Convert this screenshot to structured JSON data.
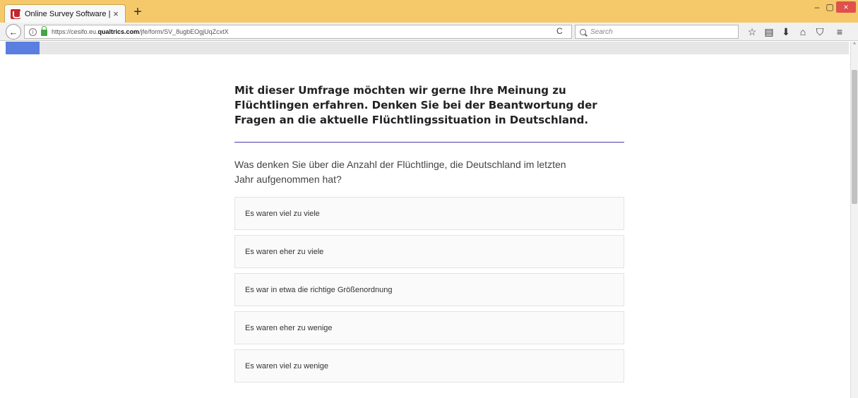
{
  "browser": {
    "tab_title": "Online Survey Software | ...",
    "tab_close": "×",
    "new_tab": "+",
    "url_prefix": "https://cesifo.eu.",
    "url_domain": "qualtrics.com",
    "url_path": "/jfe/form/SV_8ugbEOgjUqZcxtX",
    "search_placeholder": "Search",
    "reload": "C",
    "window_min": "–",
    "window_max": "▢",
    "window_close": "×",
    "back": "←",
    "info": "i",
    "toolbar_icons": [
      "star-icon",
      "reading-list-icon",
      "download-icon",
      "home-icon",
      "pocket-icon",
      "menu-icon"
    ],
    "toolbar_glyphs": [
      "☆",
      "▤",
      "⬇",
      "⌂",
      "⛉",
      "≡"
    ]
  },
  "progress": {
    "fraction": 0.04
  },
  "survey": {
    "intro": "Mit dieser Umfrage möchten wir gerne Ihre Meinung zu Flüchtlingen erfahren. Denken Sie bei der Beantwortung der Fragen an die aktuelle Flüchtlingssituation in Deutschland.",
    "question": "Was denken Sie über die Anzahl der Flüchtlinge, die Deutschland im letzten Jahr aufgenommen hat?",
    "options": [
      "Es waren viel zu viele",
      "Es waren eher zu viele",
      "Es war in etwa die richtige Größenordnung",
      "Es waren eher zu wenige",
      "Es waren viel zu wenige"
    ]
  },
  "colors": {
    "titlebar": "#f5c96a",
    "progress": "#5b7fe0",
    "divider": "#4a3fa8"
  }
}
